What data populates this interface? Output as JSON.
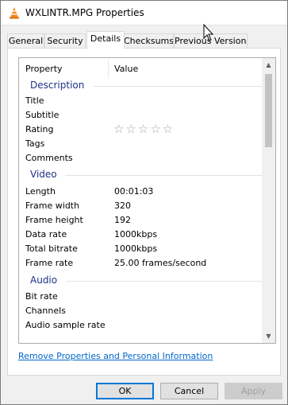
{
  "window": {
    "title": "WXLINTR.MPG Properties"
  },
  "tabs": [
    {
      "label": "General"
    },
    {
      "label": "Security"
    },
    {
      "label": "Details"
    },
    {
      "label": "Checksums"
    },
    {
      "label": "Previous Versions"
    }
  ],
  "details": {
    "header": {
      "property": "Property",
      "value": "Value"
    },
    "groups": {
      "description": {
        "label": "Description",
        "rows": [
          {
            "property": "Title",
            "value": ""
          },
          {
            "property": "Subtitle",
            "value": ""
          },
          {
            "property": "Rating",
            "value": ""
          },
          {
            "property": "Tags",
            "value": ""
          },
          {
            "property": "Comments",
            "value": ""
          }
        ]
      },
      "video": {
        "label": "Video",
        "rows": [
          {
            "property": "Length",
            "value": "00:01:03"
          },
          {
            "property": "Frame width",
            "value": "320"
          },
          {
            "property": "Frame height",
            "value": "192"
          },
          {
            "property": "Data rate",
            "value": "1000kbps"
          },
          {
            "property": "Total bitrate",
            "value": "1000kbps"
          },
          {
            "property": "Frame rate",
            "value": "25.00 frames/second"
          }
        ]
      },
      "audio": {
        "label": "Audio",
        "rows": [
          {
            "property": "Bit rate",
            "value": ""
          },
          {
            "property": "Channels",
            "value": ""
          },
          {
            "property": "Audio sample rate",
            "value": ""
          }
        ]
      }
    },
    "rating_stars": "☆☆☆☆☆",
    "rating_value": 0,
    "rating_max": 5
  },
  "remove_link": "Remove Properties and Personal Information",
  "buttons": {
    "ok": "OK",
    "cancel": "Cancel",
    "apply": "Apply"
  },
  "icons": {
    "title": "vlc-cone-icon",
    "scroll_up": "chevron-up-icon",
    "scroll_down": "chevron-down-icon",
    "cursor": "mouse-pointer-icon"
  },
  "colors": {
    "group_label": "#1e3287",
    "link": "#0066cc",
    "default_button_border": "#0078d7"
  }
}
